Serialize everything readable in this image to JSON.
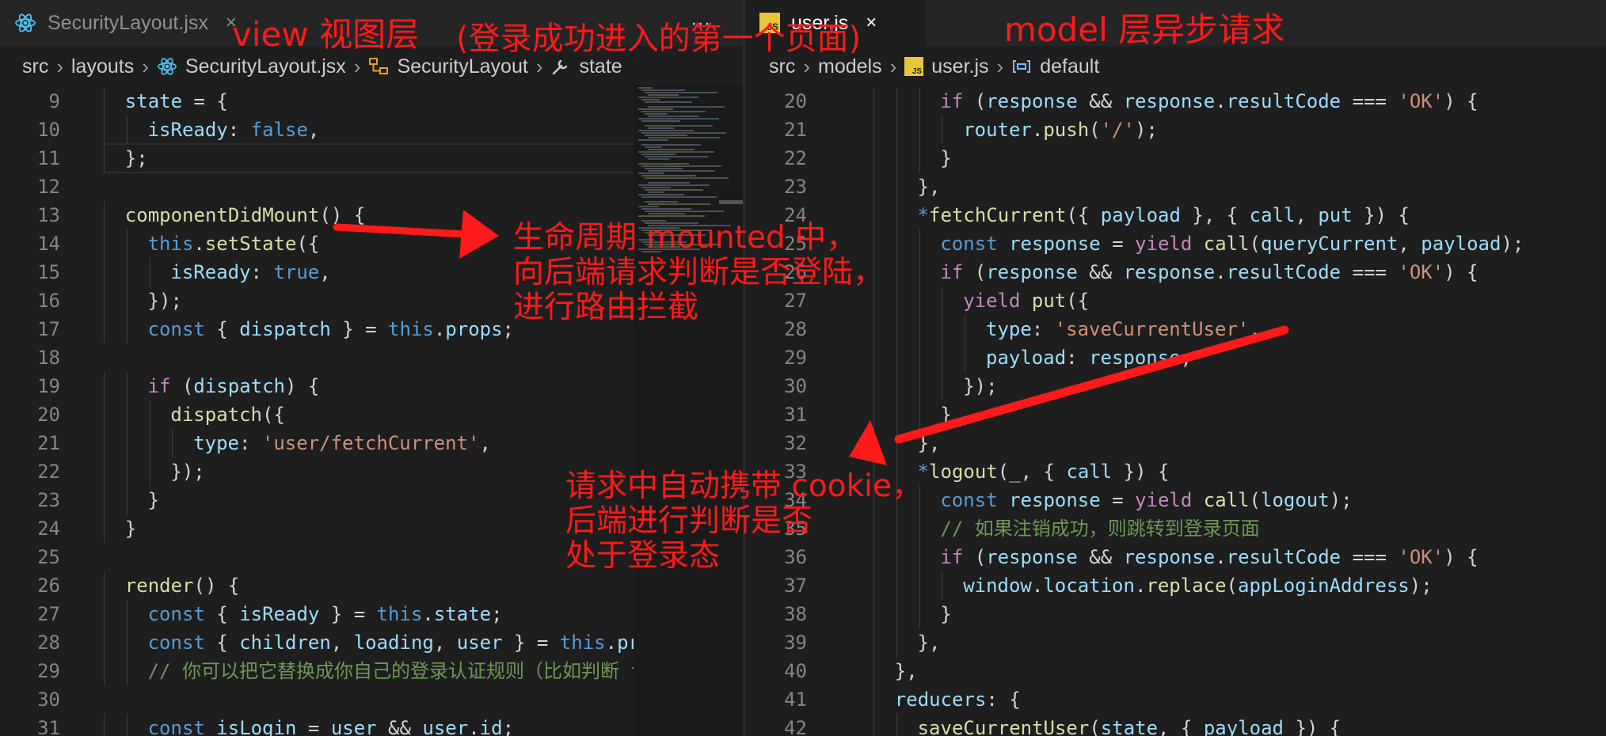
{
  "left_editor": {
    "tab": {
      "label": "SecurityLayout.jsx",
      "close": "×",
      "more": "···"
    },
    "breadcrumb": [
      "src",
      "layouts",
      "SecurityLayout.jsx",
      "SecurityLayout",
      "state"
    ],
    "lines": [
      {
        "n": "9",
        "indent": 1,
        "tokens": [
          [
            "var",
            "state"
          ],
          [
            "p",
            " = {"
          ]
        ]
      },
      {
        "n": "10",
        "indent": 2,
        "tokens": [
          [
            "prop",
            "isReady"
          ],
          [
            "p",
            ": "
          ],
          [
            "kw",
            "false"
          ],
          [
            "p",
            ","
          ]
        ]
      },
      {
        "n": "11",
        "indent": 1,
        "tokens": [
          [
            "p",
            "};"
          ]
        ]
      },
      {
        "n": "12",
        "indent": 0,
        "tokens": []
      },
      {
        "n": "13",
        "indent": 1,
        "tokens": [
          [
            "fn",
            "componentDidMount"
          ],
          [
            "p",
            "() {"
          ]
        ]
      },
      {
        "n": "14",
        "indent": 2,
        "tokens": [
          [
            "kw",
            "this"
          ],
          [
            "p",
            "."
          ],
          [
            "fn",
            "setState"
          ],
          [
            "p",
            "({"
          ]
        ]
      },
      {
        "n": "15",
        "indent": 3,
        "tokens": [
          [
            "prop",
            "isReady"
          ],
          [
            "p",
            ": "
          ],
          [
            "kw",
            "true"
          ],
          [
            "p",
            ","
          ]
        ]
      },
      {
        "n": "16",
        "indent": 2,
        "tokens": [
          [
            "p",
            "});"
          ]
        ]
      },
      {
        "n": "17",
        "indent": 2,
        "tokens": [
          [
            "kw",
            "const"
          ],
          [
            "p",
            " { "
          ],
          [
            "var",
            "dispatch"
          ],
          [
            "p",
            " } = "
          ],
          [
            "kw",
            "this"
          ],
          [
            "p",
            "."
          ],
          [
            "var",
            "props"
          ],
          [
            "p",
            ";"
          ]
        ]
      },
      {
        "n": "18",
        "indent": 0,
        "tokens": []
      },
      {
        "n": "19",
        "indent": 2,
        "tokens": [
          [
            "ctrl",
            "if"
          ],
          [
            "p",
            " ("
          ],
          [
            "var",
            "dispatch"
          ],
          [
            "p",
            ") {"
          ]
        ]
      },
      {
        "n": "20",
        "indent": 3,
        "tokens": [
          [
            "fn",
            "dispatch"
          ],
          [
            "p",
            "({"
          ]
        ]
      },
      {
        "n": "21",
        "indent": 4,
        "tokens": [
          [
            "prop",
            "type"
          ],
          [
            "p",
            ": "
          ],
          [
            "str",
            "'user/fetchCurrent'"
          ],
          [
            "p",
            ","
          ]
        ]
      },
      {
        "n": "22",
        "indent": 3,
        "tokens": [
          [
            "p",
            "});"
          ]
        ]
      },
      {
        "n": "23",
        "indent": 2,
        "tokens": [
          [
            "p",
            "}"
          ]
        ]
      },
      {
        "n": "24",
        "indent": 1,
        "tokens": [
          [
            "p",
            "}"
          ]
        ]
      },
      {
        "n": "25",
        "indent": 0,
        "tokens": []
      },
      {
        "n": "26",
        "indent": 1,
        "tokens": [
          [
            "fn",
            "render"
          ],
          [
            "p",
            "() {"
          ]
        ]
      },
      {
        "n": "27",
        "indent": 2,
        "tokens": [
          [
            "kw",
            "const"
          ],
          [
            "p",
            " { "
          ],
          [
            "var",
            "isReady"
          ],
          [
            "p",
            " } = "
          ],
          [
            "kw",
            "this"
          ],
          [
            "p",
            "."
          ],
          [
            "var",
            "state"
          ],
          [
            "p",
            ";"
          ]
        ]
      },
      {
        "n": "28",
        "indent": 2,
        "tokens": [
          [
            "kw",
            "const"
          ],
          [
            "p",
            " { "
          ],
          [
            "var",
            "children"
          ],
          [
            "p",
            ", "
          ],
          [
            "var",
            "loading"
          ],
          [
            "p",
            ", "
          ],
          [
            "var",
            "user"
          ],
          [
            "p",
            " } = "
          ],
          [
            "kw",
            "this"
          ],
          [
            "p",
            "."
          ],
          [
            "var",
            "pr"
          ]
        ]
      },
      {
        "n": "29",
        "indent": 2,
        "tokens": [
          [
            "cmt",
            "// 你可以把它替换成你自己的登录认证规则（比如判断 t"
          ]
        ]
      },
      {
        "n": "30",
        "indent": 0,
        "tokens": []
      },
      {
        "n": "31",
        "indent": 2,
        "tokens": [
          [
            "kw",
            "const"
          ],
          [
            "p",
            " "
          ],
          [
            "var",
            "isLogin"
          ],
          [
            "p",
            " = "
          ],
          [
            "var",
            "user"
          ],
          [
            "p",
            " && "
          ],
          [
            "var",
            "user"
          ],
          [
            "p",
            "."
          ],
          [
            "var",
            "id"
          ],
          [
            "p",
            ";"
          ]
        ]
      }
    ]
  },
  "right_editor": {
    "tab": {
      "label": "user.js",
      "icon_text": "JS",
      "close": "×"
    },
    "breadcrumb": [
      "src",
      "models",
      "user.js",
      "default"
    ],
    "lines": [
      {
        "n": "20",
        "indent": 3,
        "tokens": [
          [
            "ctrl",
            "if"
          ],
          [
            "p",
            " ("
          ],
          [
            "var",
            "response"
          ],
          [
            "p",
            " && "
          ],
          [
            "var",
            "response"
          ],
          [
            "p",
            "."
          ],
          [
            "var",
            "resultCode"
          ],
          [
            "p",
            " === "
          ],
          [
            "str",
            "'OK'"
          ],
          [
            "p",
            ") {"
          ]
        ]
      },
      {
        "n": "21",
        "indent": 4,
        "tokens": [
          [
            "var",
            "router"
          ],
          [
            "p",
            "."
          ],
          [
            "fn",
            "push"
          ],
          [
            "p",
            "("
          ],
          [
            "str",
            "'/'"
          ],
          [
            "p",
            ");"
          ]
        ]
      },
      {
        "n": "22",
        "indent": 3,
        "tokens": [
          [
            "p",
            "}"
          ]
        ]
      },
      {
        "n": "23",
        "indent": 2,
        "tokens": [
          [
            "p",
            "},"
          ]
        ]
      },
      {
        "n": "24",
        "indent": 2,
        "tokens": [
          [
            "kw",
            "*"
          ],
          [
            "fn",
            "fetchCurrent"
          ],
          [
            "p",
            "({ "
          ],
          [
            "var",
            "payload"
          ],
          [
            "p",
            " }, { "
          ],
          [
            "var",
            "call"
          ],
          [
            "p",
            ", "
          ],
          [
            "var",
            "put"
          ],
          [
            "p",
            " }) {"
          ]
        ]
      },
      {
        "n": "25",
        "indent": 3,
        "tokens": [
          [
            "kw",
            "const"
          ],
          [
            "p",
            " "
          ],
          [
            "var",
            "response"
          ],
          [
            "p",
            " = "
          ],
          [
            "ctrl",
            "yield"
          ],
          [
            "p",
            " "
          ],
          [
            "fn",
            "call"
          ],
          [
            "p",
            "("
          ],
          [
            "var",
            "queryCurrent"
          ],
          [
            "p",
            ", "
          ],
          [
            "var",
            "payload"
          ],
          [
            "p",
            ");"
          ]
        ]
      },
      {
        "n": "26",
        "indent": 3,
        "tokens": [
          [
            "ctrl",
            "if"
          ],
          [
            "p",
            " ("
          ],
          [
            "var",
            "response"
          ],
          [
            "p",
            " && "
          ],
          [
            "var",
            "response"
          ],
          [
            "p",
            "."
          ],
          [
            "var",
            "resultCode"
          ],
          [
            "p",
            " === "
          ],
          [
            "str",
            "'OK'"
          ],
          [
            "p",
            ") {"
          ]
        ]
      },
      {
        "n": "27",
        "indent": 4,
        "tokens": [
          [
            "ctrl",
            "yield"
          ],
          [
            "p",
            " "
          ],
          [
            "fn",
            "put"
          ],
          [
            "p",
            "({"
          ]
        ]
      },
      {
        "n": "28",
        "indent": 5,
        "tokens": [
          [
            "prop",
            "type"
          ],
          [
            "p",
            ": "
          ],
          [
            "str",
            "'saveCurrentUser'"
          ],
          [
            "p",
            ","
          ]
        ]
      },
      {
        "n": "29",
        "indent": 5,
        "tokens": [
          [
            "prop",
            "payload"
          ],
          [
            "p",
            ": "
          ],
          [
            "var",
            "response"
          ],
          [
            "p",
            ","
          ]
        ]
      },
      {
        "n": "30",
        "indent": 4,
        "tokens": [
          [
            "p",
            "});"
          ]
        ]
      },
      {
        "n": "31",
        "indent": 3,
        "tokens": [
          [
            "p",
            "}"
          ]
        ]
      },
      {
        "n": "32",
        "indent": 2,
        "tokens": [
          [
            "p",
            "},"
          ]
        ]
      },
      {
        "n": "33",
        "indent": 2,
        "tokens": [
          [
            "kw",
            "*"
          ],
          [
            "fn",
            "logout"
          ],
          [
            "p",
            "("
          ],
          [
            "var",
            "_"
          ],
          [
            "p",
            ", { "
          ],
          [
            "var",
            "call"
          ],
          [
            "p",
            " }) {"
          ]
        ]
      },
      {
        "n": "34",
        "indent": 3,
        "tokens": [
          [
            "kw",
            "const"
          ],
          [
            "p",
            " "
          ],
          [
            "var",
            "response"
          ],
          [
            "p",
            " = "
          ],
          [
            "ctrl",
            "yield"
          ],
          [
            "p",
            " "
          ],
          [
            "fn",
            "call"
          ],
          [
            "p",
            "("
          ],
          [
            "var",
            "logout"
          ],
          [
            "p",
            ");"
          ]
        ]
      },
      {
        "n": "35",
        "indent": 3,
        "tokens": [
          [
            "cmt",
            "// 如果注销成功，则跳转到登录页面"
          ]
        ]
      },
      {
        "n": "36",
        "indent": 3,
        "tokens": [
          [
            "ctrl",
            "if"
          ],
          [
            "p",
            " ("
          ],
          [
            "var",
            "response"
          ],
          [
            "p",
            " && "
          ],
          [
            "var",
            "response"
          ],
          [
            "p",
            "."
          ],
          [
            "var",
            "resultCode"
          ],
          [
            "p",
            " === "
          ],
          [
            "str",
            "'OK'"
          ],
          [
            "p",
            ") {"
          ]
        ]
      },
      {
        "n": "37",
        "indent": 4,
        "tokens": [
          [
            "var",
            "window"
          ],
          [
            "p",
            "."
          ],
          [
            "var",
            "location"
          ],
          [
            "p",
            "."
          ],
          [
            "fn",
            "replace"
          ],
          [
            "p",
            "("
          ],
          [
            "var",
            "appLoginAddress"
          ],
          [
            "p",
            ");"
          ]
        ]
      },
      {
        "n": "38",
        "indent": 3,
        "tokens": [
          [
            "p",
            "}"
          ]
        ]
      },
      {
        "n": "39",
        "indent": 2,
        "tokens": [
          [
            "p",
            "},"
          ]
        ]
      },
      {
        "n": "40",
        "indent": 1,
        "tokens": [
          [
            "p",
            "},"
          ]
        ]
      },
      {
        "n": "41",
        "indent": 1,
        "tokens": [
          [
            "var",
            "reducers"
          ],
          [
            "p",
            ": {"
          ]
        ]
      },
      {
        "n": "42",
        "indent": 2,
        "tokens": [
          [
            "fn",
            "saveCurrentUser"
          ],
          [
            "p",
            "("
          ],
          [
            "var",
            "state"
          ],
          [
            "p",
            ", { "
          ],
          [
            "var",
            "payload"
          ],
          [
            "p",
            " }) {"
          ]
        ]
      }
    ]
  },
  "annotations": {
    "view_layer": "view 视图层",
    "first_page": "(登录成功进入的第一个页面)",
    "model_layer": "model 层异步请求",
    "mounted_note": [
      "生命周期 mounted 中，",
      "向后端请求判断是否登陆，",
      "进行路由拦截"
    ],
    "cookie_note": [
      "请求中自动携带 cookie，",
      "后端进行判断是否",
      "处于登录态"
    ]
  },
  "colors": {
    "annotation_red": "#ff1a1a",
    "editor_bg": "#1e1e1e",
    "tab_bar_bg": "#252526",
    "react_icon": "#4fc3f7",
    "js_icon": "#e8c63a"
  }
}
